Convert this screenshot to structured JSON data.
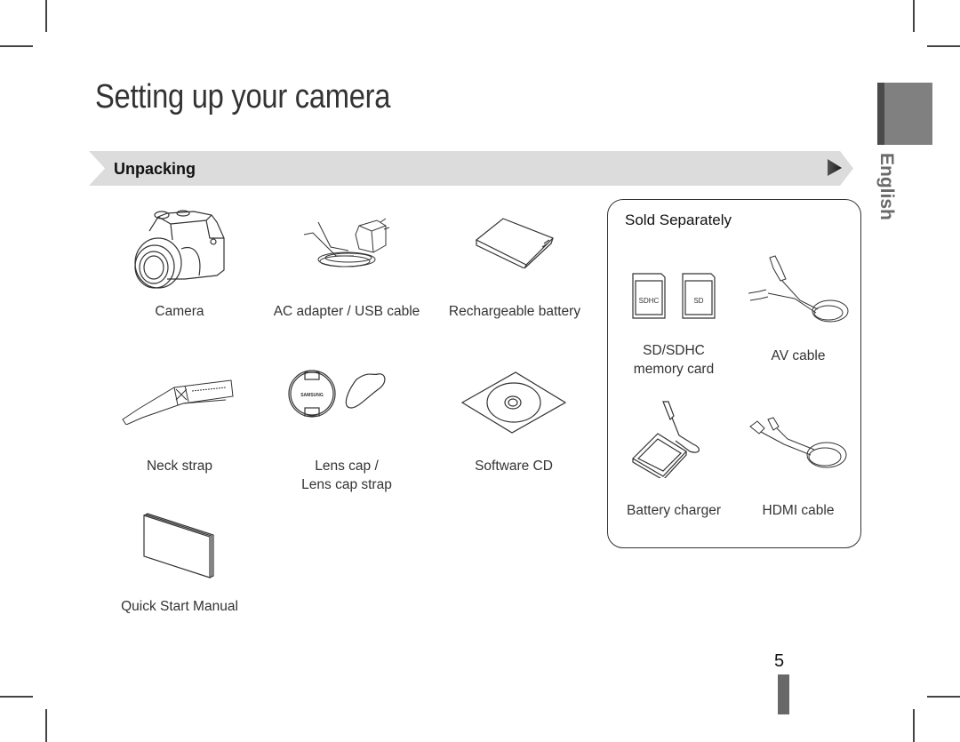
{
  "page": {
    "title": "Setting up your camera",
    "section": "Unpacking",
    "language_tab": "English",
    "page_number": "5"
  },
  "included_items": [
    {
      "id": "camera",
      "label": "Camera",
      "icon": "camera-icon"
    },
    {
      "id": "ac-adapter",
      "label": "AC adapter / USB cable",
      "icon": "ac-adapter-icon"
    },
    {
      "id": "battery",
      "label": "Rechargeable battery",
      "icon": "battery-icon"
    },
    {
      "id": "neck-strap",
      "label": "Neck strap",
      "icon": "neck-strap-icon"
    },
    {
      "id": "lens-cap",
      "label_line1": "Lens cap /",
      "label_line2": "Lens cap strap",
      "icon": "lens-cap-icon"
    },
    {
      "id": "software-cd",
      "label": "Software CD",
      "icon": "cd-icon"
    },
    {
      "id": "manual",
      "label": "Quick Start Manual",
      "icon": "manual-icon"
    }
  ],
  "sold_separately": {
    "title": "Sold Separately",
    "items": [
      {
        "id": "memory-card",
        "label_line1": "SD/SDHC",
        "label_line2": "memory card",
        "icon": "memory-card-icon",
        "card_labels": [
          "SDHC",
          "SD"
        ]
      },
      {
        "id": "av-cable",
        "label": "AV cable",
        "icon": "av-cable-icon"
      },
      {
        "id": "battery-charger",
        "label": "Battery charger",
        "icon": "battery-charger-icon"
      },
      {
        "id": "hdmi-cable",
        "label": "HDMI cable",
        "icon": "hdmi-cable-icon"
      }
    ]
  },
  "brand_text": "SAMSUNG"
}
